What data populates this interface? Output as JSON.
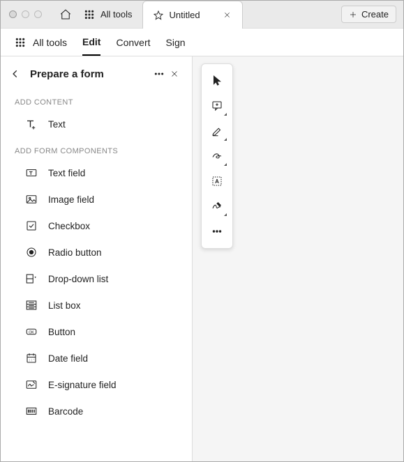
{
  "titlebar": {
    "alltools_label": "All tools",
    "active_tab_label": "Untitled",
    "create_label": "Create"
  },
  "toolbar": {
    "alltools": "All tools",
    "edit": "Edit",
    "convert": "Convert",
    "sign": "Sign"
  },
  "sidebar": {
    "title": "Prepare a form",
    "groups": {
      "add_content": "ADD CONTENT",
      "add_form_components": "ADD FORM COMPONENTS"
    },
    "content_items": [
      {
        "label": "Text"
      }
    ],
    "form_items": [
      {
        "label": "Text field"
      },
      {
        "label": "Image field"
      },
      {
        "label": "Checkbox"
      },
      {
        "label": "Radio button"
      },
      {
        "label": "Drop-down list"
      },
      {
        "label": "List box"
      },
      {
        "label": "Button"
      },
      {
        "label": "Date field"
      },
      {
        "label": "E-signature field"
      },
      {
        "label": "Barcode"
      }
    ]
  },
  "float_toolbar_icons": [
    "arrow-cursor-icon",
    "comment-icon",
    "highlight-icon",
    "draw-freeform-icon",
    "text-select-icon",
    "signature-icon",
    "more-icon"
  ]
}
